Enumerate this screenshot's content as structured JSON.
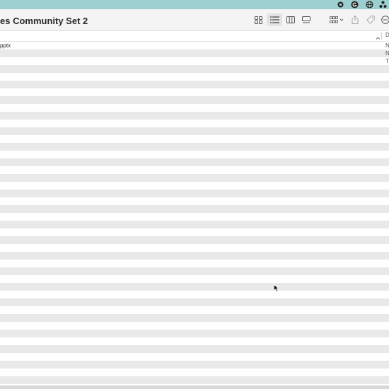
{
  "window": {
    "title": "es Community Set 2"
  },
  "menubar": {
    "icons": [
      "record-icon",
      "grammarly-icon",
      "vpn-icon",
      "shortcuts-icon"
    ]
  },
  "toolbar": {
    "views": [
      {
        "name": "icon-view-button",
        "icon": "grid-icon",
        "active": false
      },
      {
        "name": "list-view-button",
        "icon": "list-icon",
        "active": true
      },
      {
        "name": "column-view-button",
        "icon": "columns-icon",
        "active": false
      },
      {
        "name": "gallery-view-button",
        "icon": "gallery-icon",
        "active": false
      }
    ],
    "actions": [
      "group-by-button",
      "share-button",
      "tags-button",
      "more-button"
    ]
  },
  "columns": {
    "kind_header": "D"
  },
  "files": [
    {
      "name": "pptx",
      "kind": "N"
    },
    {
      "name": "",
      "kind": "N"
    },
    {
      "name": "",
      "kind": "T"
    }
  ],
  "colors": {
    "menubar": "#9ccfcf",
    "stripe": "#e9e9e9",
    "toolbar": "#f4f4f4"
  }
}
